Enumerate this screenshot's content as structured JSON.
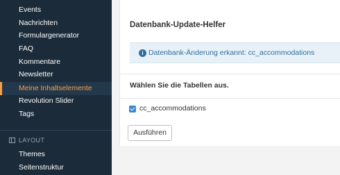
{
  "sidebar": {
    "items": [
      {
        "label": "Events"
      },
      {
        "label": "Nachrichten"
      },
      {
        "label": "Formulargenerator"
      },
      {
        "label": "FAQ"
      },
      {
        "label": "Kommentare"
      },
      {
        "label": "Newsletter"
      },
      {
        "label": "Meine Inhaltselemente",
        "active": true
      },
      {
        "label": "Revolution Slider"
      },
      {
        "label": "Tags"
      }
    ],
    "section_header": "LAYOUT",
    "layout_items": [
      {
        "label": "Themes"
      },
      {
        "label": "Seitenstruktur"
      }
    ]
  },
  "main": {
    "title": "Datenbank-Update-Helfer",
    "info_message": "Datenbank-Änderung erkannt: cc_accommodations",
    "select_tables_label": "Wählen Sie die Tabellen aus.",
    "tables": [
      {
        "label": "cc_accommodations",
        "checked": true
      }
    ],
    "execute_button": "Ausführen"
  },
  "colors": {
    "sidebar_bg": "#1c2b39",
    "active_accent": "#f5a046",
    "info_text": "#2f6e9e",
    "checkbox": "#3a86d8"
  },
  "icons": {
    "info": "info-circle-icon",
    "layout": "layout-icon",
    "checkbox": "checkmark-icon"
  }
}
